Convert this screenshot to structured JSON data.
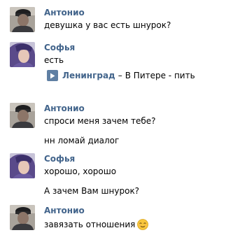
{
  "messages": [
    {
      "author": "Антонио",
      "lines": [
        "девушка у вас есть шнурок?"
      ]
    },
    {
      "author": "Софья",
      "lines": [
        "есть"
      ],
      "audio": {
        "artist": "Ленинград",
        "separator": "–",
        "title": "В Питере - пить",
        "icon": "play-icon"
      }
    },
    {
      "author": "Антонио",
      "lines": [
        "спроси меня зачем тебе?",
        "нн ломай диалог"
      ]
    },
    {
      "author": "Софья",
      "lines": [
        "хорошо, хорошо",
        "А зачем Вам шнурок?"
      ]
    },
    {
      "author": "Антонио",
      "lines": [
        "завязать отношения"
      ],
      "emoji": "relieved-face-emoji"
    }
  ],
  "colors": {
    "author_name": "#42648b",
    "play_button": "#5f7fa3",
    "text": "#000000"
  }
}
